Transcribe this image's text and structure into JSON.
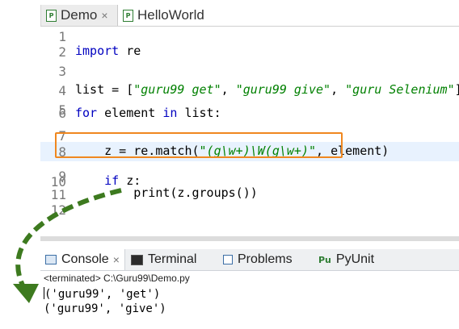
{
  "editor_tabs": [
    {
      "label": "Demo",
      "close": "×"
    },
    {
      "label": "HelloWorld"
    }
  ],
  "editor": {
    "line_numbers": [
      "1",
      "2",
      "3",
      "4",
      "5",
      "6",
      "7",
      "8",
      "9",
      "10",
      "11",
      "12"
    ],
    "line2": {
      "kw": "import",
      "rest": " re"
    },
    "line4": {
      "pre": "list = [",
      "s1": "\"guru99 get\"",
      "c1": ", ",
      "s2": "\"guru99 give\"",
      "c2": ", ",
      "s3": "\"guru Selenium\"",
      "post": "]"
    },
    "line6": {
      "kw1": "for",
      "mid": " element ",
      "kw2": "in",
      "post": " list:"
    },
    "line8": {
      "pre": "    z = re.match(",
      "str": "\"(g\\w+)\\W(g\\w+)\"",
      "post": ", element)"
    },
    "line10": {
      "indent": "    ",
      "kw": "if",
      "post": " z:"
    },
    "line11": {
      "text": "        print(z.groups())"
    }
  },
  "console": {
    "tabs": [
      {
        "label": "Console",
        "close": "×"
      },
      {
        "label": "Terminal"
      },
      {
        "label": "Problems"
      },
      {
        "label": "PyUnit",
        "icon_text": "Pu"
      }
    ],
    "terminated": "<terminated> C:\\Guru99\\Demo.py",
    "output": [
      "('guru99', 'get')",
      "('guru99', 'give')"
    ]
  },
  "colors": {
    "highlight_box": "#f0871f",
    "arrow": "#3d7a1f",
    "keyword": "#0000c0",
    "string": "#008000"
  }
}
